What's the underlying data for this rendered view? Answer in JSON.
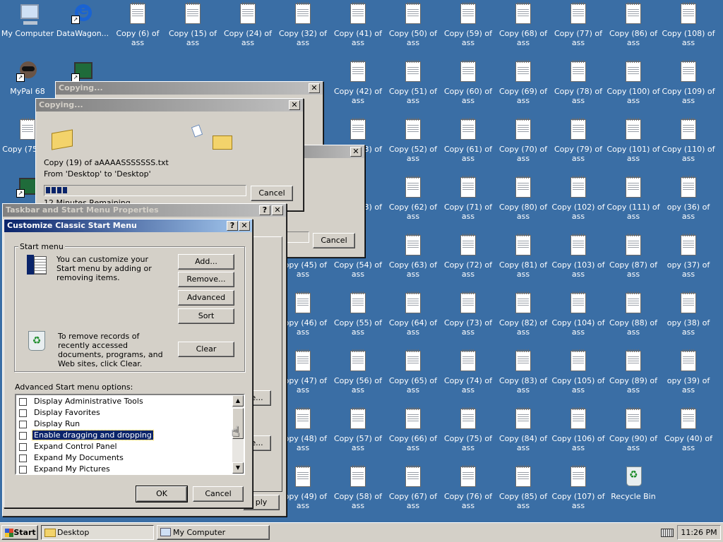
{
  "desktop": {
    "background_color": "#3a6ea5",
    "icons": [
      {
        "label": "My Computer",
        "type": "computer"
      },
      {
        "label": "DataWagon...",
        "type": "ie"
      },
      {
        "label": "Copy (6) of ass",
        "type": "doc"
      },
      {
        "label": "Copy (15) of ass",
        "type": "doc"
      },
      {
        "label": "Copy (24) of ass",
        "type": "doc"
      },
      {
        "label": "Copy (32) of ass",
        "type": "doc"
      },
      {
        "label": "Copy (41) of ass",
        "type": "doc"
      },
      {
        "label": "Copy (50) of ass",
        "type": "doc"
      },
      {
        "label": "Copy (59) of ass",
        "type": "doc"
      },
      {
        "label": "Copy (68) of ass",
        "type": "doc"
      },
      {
        "label": "Copy (77) of ass",
        "type": "doc"
      },
      {
        "label": "Copy (86) of ass",
        "type": "doc"
      },
      {
        "label": "Copy (108) of ass",
        "type": "doc"
      },
      {
        "label": "MyPal 68",
        "type": "raccoon"
      },
      {
        "label": "",
        "type": "monitor"
      },
      {
        "label": "Copy (42) of ass",
        "type": "doc"
      },
      {
        "label": "Copy (51) of ass",
        "type": "doc"
      },
      {
        "label": "Copy (60) of ass",
        "type": "doc"
      },
      {
        "label": "Copy (69) of ass",
        "type": "doc"
      },
      {
        "label": "Copy (78) of ass",
        "type": "doc"
      },
      {
        "label": "Copy (100) of ass",
        "type": "doc"
      },
      {
        "label": "Copy (109) of ass",
        "type": "doc"
      },
      {
        "label": "Copy (75 ass",
        "type": "doc"
      },
      {
        "label": "Copy (43) of ass",
        "type": "doc"
      },
      {
        "label": "Copy (52) of ass",
        "type": "doc"
      },
      {
        "label": "Copy (61) of ass",
        "type": "doc"
      },
      {
        "label": "Copy (70) of ass",
        "type": "doc"
      },
      {
        "label": "Copy (79) of ass",
        "type": "doc"
      },
      {
        "label": "Copy (101) of ass",
        "type": "doc"
      },
      {
        "label": "Copy (110) of ass",
        "type": "doc"
      },
      {
        "label": "",
        "type": "app"
      },
      {
        "label": "4) of ass",
        "type": "doc"
      },
      {
        "label": "Copy (53) of ass",
        "type": "doc"
      },
      {
        "label": "Copy (62) of ass",
        "type": "doc"
      },
      {
        "label": "Copy (71) of ass",
        "type": "doc"
      },
      {
        "label": "Copy (80) of ass",
        "type": "doc"
      },
      {
        "label": "Copy (102) of ass",
        "type": "doc"
      },
      {
        "label": "Copy (111) of ass",
        "type": "doc"
      },
      {
        "label": "opy (36) of ass",
        "type": "doc"
      },
      {
        "label": "Copy (45) of ass",
        "type": "doc"
      },
      {
        "label": "Copy (54) of ass",
        "type": "doc"
      },
      {
        "label": "Copy (63) of ass",
        "type": "doc"
      },
      {
        "label": "Copy (72) of ass",
        "type": "doc"
      },
      {
        "label": "Copy (81) of ass",
        "type": "doc"
      },
      {
        "label": "Copy (103) of ass",
        "type": "doc"
      },
      {
        "label": "Copy (87) of ass",
        "type": "doc"
      },
      {
        "label": "opy (37) of ass",
        "type": "doc"
      },
      {
        "label": "Copy (46) of ass",
        "type": "doc"
      },
      {
        "label": "Copy (55) of ass",
        "type": "doc"
      },
      {
        "label": "Copy (64) of ass",
        "type": "doc"
      },
      {
        "label": "Copy (73) of ass",
        "type": "doc"
      },
      {
        "label": "Copy (82) of ass",
        "type": "doc"
      },
      {
        "label": "Copy (104) of ass",
        "type": "doc"
      },
      {
        "label": "Copy (88) of ass",
        "type": "doc"
      },
      {
        "label": "opy (38) of ass",
        "type": "doc"
      },
      {
        "label": "Copy (47) of ass",
        "type": "doc"
      },
      {
        "label": "Copy (56) of ass",
        "type": "doc"
      },
      {
        "label": "Copy (65) of ass",
        "type": "doc"
      },
      {
        "label": "Copy (74) of ass",
        "type": "doc"
      },
      {
        "label": "Copy (83) of ass",
        "type": "doc"
      },
      {
        "label": "Copy (105) of ass",
        "type": "doc"
      },
      {
        "label": "Copy (89) of ass",
        "type": "doc"
      },
      {
        "label": "opy (39) of ass",
        "type": "doc"
      },
      {
        "label": "Copy (48) of ass",
        "type": "doc"
      },
      {
        "label": "Copy (57) of ass",
        "type": "doc"
      },
      {
        "label": "Copy (66) of ass",
        "type": "doc"
      },
      {
        "label": "Copy (75) of ass",
        "type": "doc"
      },
      {
        "label": "Copy (84) of ass",
        "type": "doc"
      },
      {
        "label": "Copy (106) of ass",
        "type": "doc"
      },
      {
        "label": "Copy (90) of ass",
        "type": "doc"
      },
      {
        "label": "Copy (40) of ass",
        "type": "doc"
      },
      {
        "label": "Copy (49) of ass",
        "type": "doc"
      },
      {
        "label": "Copy (58) of ass",
        "type": "doc"
      },
      {
        "label": "Copy (67) of ass",
        "type": "doc"
      },
      {
        "label": "Copy (76) of ass",
        "type": "doc"
      },
      {
        "label": "Copy (85) of ass",
        "type": "doc"
      },
      {
        "label": "Copy (107) of ass",
        "type": "doc"
      },
      {
        "label": "Recycle Bin",
        "type": "bin"
      }
    ]
  },
  "copy_dialog_back": {
    "title": "Copying...",
    "cancel_label": "Cancel"
  },
  "copy_dialog": {
    "title": "Copying...",
    "file_line": "Copy (19) of aAAAASSSSSSS.txt",
    "from_line": "From 'Desktop' to 'Desktop'",
    "remaining_text": "12 Minutes Remaining",
    "cancel_label": "Cancel",
    "progress_blocks": 4
  },
  "taskbar_props": {
    "title": "Taskbar and Start Menu Properties",
    "help_label": "?",
    "close_label": "✕",
    "partial_button_1": "e...",
    "partial_button_2": "e...",
    "partial_apply": "ply"
  },
  "customize": {
    "title": "Customize Classic Start Menu",
    "help_label": "?",
    "close_label": "✕",
    "group_label": "Start menu",
    "customize_text": "You can customize your Start menu by adding or removing items.",
    "clear_text": "To remove records of recently accessed documents, programs, and Web sites, click Clear.",
    "buttons": {
      "add": "Add...",
      "remove": "Remove...",
      "advanced": "Advanced",
      "sort": "Sort",
      "clear": "Clear",
      "ok": "OK",
      "cancel": "Cancel"
    },
    "options_label": "Advanced Start menu options:",
    "options": [
      {
        "label": "Display Administrative Tools",
        "checked": false,
        "selected": false
      },
      {
        "label": "Display Favorites",
        "checked": false,
        "selected": false
      },
      {
        "label": "Display Run",
        "checked": false,
        "selected": false
      },
      {
        "label": "Enable dragging and dropping",
        "checked": false,
        "selected": true
      },
      {
        "label": "Expand Control Panel",
        "checked": false,
        "selected": false
      },
      {
        "label": "Expand My Documents",
        "checked": false,
        "selected": false
      },
      {
        "label": "Expand My Pictures",
        "checked": false,
        "selected": false
      }
    ]
  },
  "taskbar": {
    "start_label": "Start",
    "tasks": [
      {
        "label": "Desktop",
        "icon": "folder-icon",
        "pressed": true
      },
      {
        "label": "My Computer",
        "icon": "computer-icon",
        "pressed": false
      }
    ],
    "clock": "11:26 PM"
  }
}
